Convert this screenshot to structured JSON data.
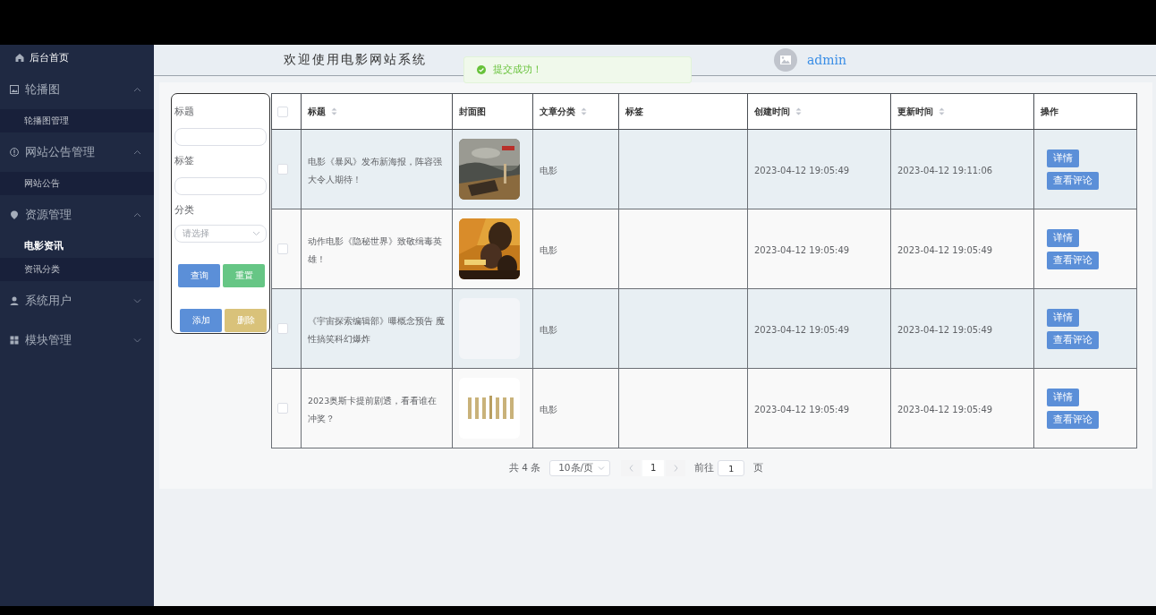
{
  "sidebar": {
    "items": [
      {
        "kind": "link",
        "label": "后台首页"
      },
      {
        "kind": "group",
        "label": "轮播图",
        "expanded": true,
        "children": [
          {
            "label": "轮播图管理",
            "selected": false
          }
        ]
      },
      {
        "kind": "group",
        "label": "网站公告管理",
        "expanded": true,
        "children": [
          {
            "label": "网站公告",
            "selected": false
          }
        ]
      },
      {
        "kind": "group",
        "label": "资源管理",
        "expanded": true,
        "children": [
          {
            "label": "电影资讯",
            "selected": true
          },
          {
            "label": "资讯分类",
            "selected": false
          }
        ]
      },
      {
        "kind": "group",
        "label": "系统用户",
        "expanded": false
      },
      {
        "kind": "group",
        "label": "模块管理",
        "expanded": false
      }
    ]
  },
  "header": {
    "title": "欢迎使用电影网站系统",
    "user": "admin"
  },
  "toast": {
    "message": "提交成功！"
  },
  "filter": {
    "fields": [
      {
        "kind": "input",
        "label": "标题"
      },
      {
        "kind": "input",
        "label": "标签"
      },
      {
        "kind": "select",
        "label": "分类",
        "placeholder": "请选择"
      }
    ],
    "buttons": [
      {
        "label": "查询",
        "kind": "primary"
      },
      {
        "label": "重置",
        "kind": "success"
      },
      {
        "label": "添加",
        "kind": "primary"
      },
      {
        "label": "删除",
        "kind": "warning"
      }
    ]
  },
  "table": {
    "select_all": {
      "checked": false
    },
    "columns": [
      {
        "label": "标题",
        "sortable": true
      },
      {
        "label": "封面图",
        "sortable": false
      },
      {
        "label": "文章分类",
        "sortable": true
      },
      {
        "label": "标签",
        "sortable": false
      },
      {
        "label": "创建时间",
        "sortable": true
      },
      {
        "label": "更新时间",
        "sortable": true
      },
      {
        "label": "操作",
        "sortable": false
      }
    ],
    "rows": [
      {
        "checked": false,
        "title": "电影《暴风》发布新海报，阵容强大令人期待！",
        "cover": {
          "kind": "picture"
        },
        "category": "电影",
        "created": "2023-04-12 19:05:49",
        "updated": "2023-04-12 19:11:06",
        "actions": [
          "详情",
          "查看评论"
        ]
      },
      {
        "checked": false,
        "title": "动作电影《隐秘世界》致敬缉毒英雄！",
        "cover": {
          "kind": "picture"
        },
        "category": "电影",
        "created": "2023-04-12 19:05:49",
        "updated": "2023-04-12 19:05:49",
        "actions": [
          "详情",
          "查看评论"
        ]
      },
      {
        "checked": false,
        "title": "《宇宙探索编辑部》曝概念预告 魔性搞笑科幻爆炸",
        "cover": {
          "kind": "empty"
        },
        "category": "电影",
        "created": "2023-04-12 19:05:49",
        "updated": "2023-04-12 19:05:49",
        "actions": [
          "详情",
          "查看评论"
        ]
      },
      {
        "checked": false,
        "title": "2023奥斯卡提前剧透，看看谁在冲奖？",
        "cover": {
          "kind": "picture"
        },
        "category": "电影",
        "created": "2023-04-12 19:05:49",
        "updated": "2023-04-12 19:05:49",
        "actions": [
          "详情",
          "查看评论"
        ]
      }
    ]
  },
  "pagination": {
    "total": "共 4 条",
    "page_size": "10条/页",
    "pages": [
      {
        "label": "1",
        "selected": true
      }
    ],
    "goto_label": "前往",
    "goto_value": "1",
    "goto_suffix": "页"
  }
}
